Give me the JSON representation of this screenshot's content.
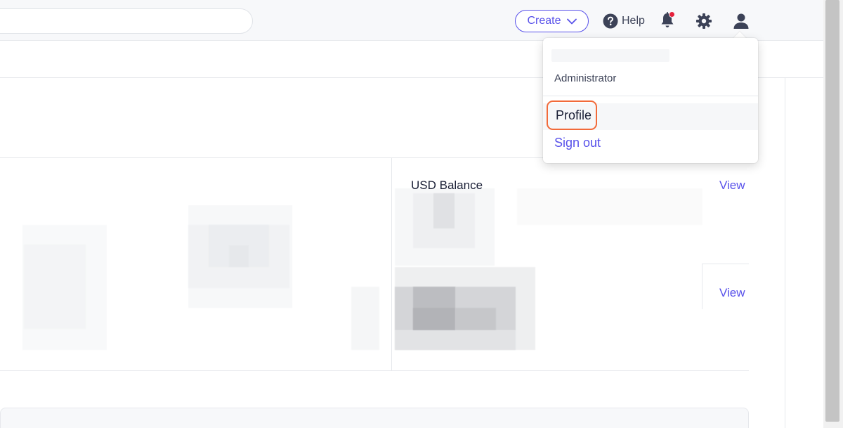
{
  "header": {
    "search": {
      "placeholder": ""
    },
    "create_label": "Create",
    "help_label": "Help",
    "icons": [
      "chevron-down-icon",
      "help-circle-icon",
      "bell-icon",
      "gear-icon",
      "user-icon"
    ],
    "notification_dot_color": "#e5213b"
  },
  "balance": {
    "usd_label": "USD Balance",
    "view_label_1": "View",
    "view_label_2": "View"
  },
  "user_menu": {
    "role": "Administrator",
    "items": [
      {
        "label": "Profile",
        "highlighted": true
      },
      {
        "label": "Sign out"
      }
    ]
  },
  "colors": {
    "accent": "#5851ea",
    "highlight_outline": "#f26a3a",
    "top_bar_bg": "#f7f8fa"
  }
}
